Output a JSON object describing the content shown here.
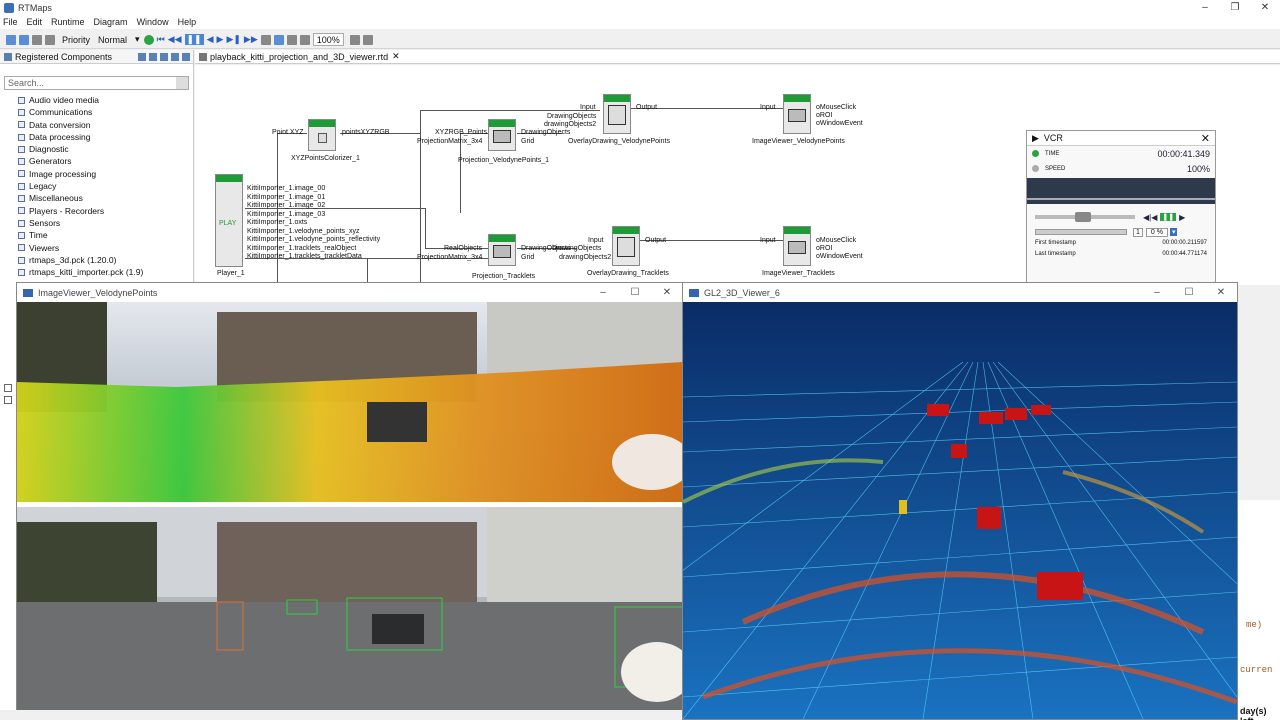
{
  "app": {
    "title": "RTMaps"
  },
  "menu": [
    "File",
    "Edit",
    "Runtime",
    "Diagram",
    "Window",
    "Help"
  ],
  "toolbar": {
    "priority_label": "Priority",
    "priority_value": "Normal",
    "zoom_value": "100%"
  },
  "left_panel": {
    "tab_label": "Registered Components",
    "search_placeholder": "Search...",
    "items": [
      "Audio video media",
      "Communications",
      "Data conversion",
      "Data processing",
      "Diagnostic",
      "Generators",
      "Image processing",
      "Legacy",
      "Miscellaneous",
      "Players - Recorders",
      "Sensors",
      "Time",
      "Viewers",
      "rtmaps_3d.pck (1.20.0)",
      "rtmaps_kitti_importer.pck (1.9)"
    ]
  },
  "editor": {
    "tab_label": "playback_kitti_projection_and_3D_viewer.rtd"
  },
  "diagram": {
    "player": {
      "label": "Player_1",
      "inner": "PLAY",
      "outputs": [
        "KittiImporter_1.image_00",
        "KittiImporter_1.image_01",
        "KittiImporter_1.image_02",
        "KittiImporter_1.image_03",
        "KittiImporter_1.oxts",
        "KittiImporter_1.velodyne_points_xyz",
        "KittiImporter_1.velodyne_points_reflectivity",
        "KittiImporter_1.tracklets_realObject",
        "KittiImporter_1.tracklets_trackletData"
      ]
    },
    "colorizer": {
      "label": "XYZPointsColorizer_1",
      "in": "Point XYZ",
      "out": "pointsXYZRGB"
    },
    "proj_velo": {
      "label": "Projection_VelodynePoints_1",
      "in1": "XYZRGB_Points",
      "in2": "ProjectionMatrix_3x4",
      "out1": "DrawingObjects",
      "out2": "Grid"
    },
    "overlay_velo": {
      "label": "OverlayDrawing_VelodynePoints",
      "in1": "Input",
      "in2": "DrawingObjects",
      "in3": "drawingObjects2",
      "out": "Output"
    },
    "viewer_velo": {
      "label": "ImageViewer_VelodynePoints",
      "in": "Input",
      "out1": "oMouseClick",
      "out2": "oROI",
      "out3": "oWindowEvent"
    },
    "proj_track": {
      "label": "Projection_Tracklets",
      "in1": "RealObjects",
      "in2": "ProjectionMatrix_3x4",
      "out1": "DrawingObjects",
      "out2": "Grid"
    },
    "overlay_track": {
      "label": "OverlayDrawing_Tracklets",
      "in1": "Input",
      "in2": "DrawingObjects",
      "in3": "drawingObjects2",
      "out": "Output"
    },
    "viewer_track": {
      "label": "ImageViewer_Tracklets",
      "in": "Input",
      "out1": "oMouseClick",
      "out2": "oROI",
      "out3": "oWindowEvent"
    }
  },
  "vcr": {
    "title": "VCR",
    "time_label": "TIME",
    "time_value": "00:00:41.349",
    "speed_label": "SPEED",
    "speed_value": "100%",
    "loop_count": "1",
    "percent": "0 %",
    "first_label": "First timestamp",
    "first_value": "00:00:00.211597",
    "last_label": "Last timestamp",
    "last_value": "00:00:44.771174"
  },
  "image_viewer": {
    "title": "ImageViewer_VelodynePoints"
  },
  "gl_viewer": {
    "title": "GL2_3D_Viewer_6"
  },
  "right_panel": {
    "partial_text_1": "me)",
    "partial_text_2": "curren",
    "status": "day(s) left"
  },
  "colors": {
    "component_header": "#1e9a36",
    "gl_background": "#0d3c78",
    "grid": "#4fd0ff"
  }
}
